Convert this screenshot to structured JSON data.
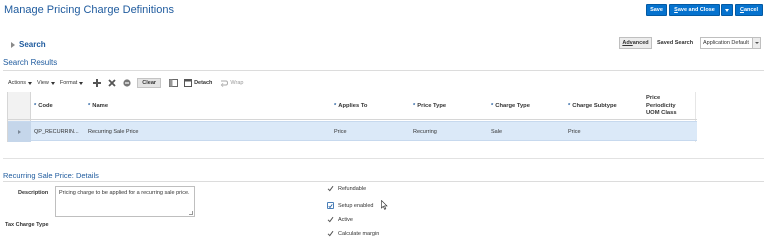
{
  "page": {
    "title": "Manage Pricing Charge Definitions"
  },
  "actions": {
    "save": "Save",
    "save_and_close_underlined": "S",
    "save_and_close_rest": "ave and Close",
    "cancel_underlined": "C",
    "cancel_rest": "ancel"
  },
  "search": {
    "label": "Search",
    "advanced_underlined": "Adv",
    "advanced_rest": "anced",
    "saved_search_label": "Saved Search",
    "saved_search_value": "Application Default"
  },
  "results": {
    "header": "Search Results",
    "toolbar": {
      "actions": "Actions",
      "view": "View",
      "format": "Format",
      "clear": "Clear",
      "detach": "Detach",
      "wrap": "Wrap"
    },
    "columns": [
      "Code",
      "Name",
      "Applies To",
      "Price Type",
      "Charge Type",
      "Charge Subtype"
    ],
    "column_last_line1": "Price",
    "column_last_line2": "Periodicity",
    "column_last_line3": "UOM Class",
    "rows": [
      {
        "code": "QP_RECURRIN...",
        "name": "Recurring Sale Price",
        "applies_to": "Price",
        "price_type": "Recurring",
        "charge_type": "Sale",
        "charge_subtype": "Price",
        "periodicity": ""
      }
    ]
  },
  "details": {
    "header": "Recurring Sale Price: Details",
    "description_label": "Description",
    "description_value": "Pricing charge to be applied for a recurring sale price.",
    "tax_charge_type_label": "Tax Charge Type",
    "checks": {
      "refundable": "Refundable",
      "setup_enabled": "Setup enabled",
      "active": "Active",
      "calculate_margin": "Calculate margin"
    }
  },
  "colors": {
    "brand_blue": "#0572ce",
    "title_blue": "#1f5b9e",
    "selected_row": "#dbe9f8"
  }
}
